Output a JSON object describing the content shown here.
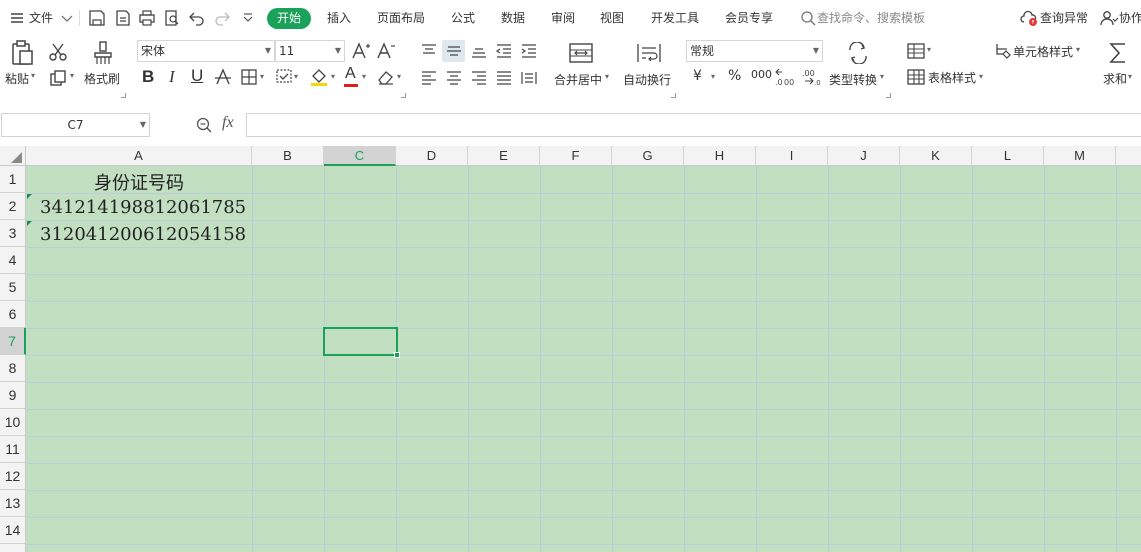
{
  "menubar": {
    "file": "文件",
    "tabs": [
      "开始",
      "插入",
      "页面布局",
      "公式",
      "数据",
      "审阅",
      "视图",
      "开发工具",
      "会员专享"
    ],
    "search_placeholder": "查找命令、搜索模板",
    "check_error": "查询异常",
    "collab": "协作"
  },
  "ribbon": {
    "paste": "粘贴",
    "format_painter": "格式刷",
    "font_name": "宋体",
    "font_size": "11",
    "bold": "B",
    "italic": "I",
    "underline": "U",
    "font_color_letter": "A",
    "merge_center": "合并居中",
    "wrap_text": "自动换行",
    "number_format": "常规",
    "currency": "¥",
    "percent": "%",
    "thousands": "000",
    "type_convert": "类型转换",
    "table_style": "表格样式",
    "cell_style": "单元格样式",
    "sum": "求和",
    "colors": {
      "font_color": "#e02020",
      "fill_color": "#f5d90a",
      "active_tab": "#1aa15a"
    }
  },
  "formula_bar": {
    "name_box": "C7",
    "fx_label": "fx",
    "formula": ""
  },
  "sheet": {
    "columns": [
      "A",
      "B",
      "C",
      "D",
      "E",
      "F",
      "G",
      "H",
      "I",
      "J",
      "K",
      "L",
      "M"
    ],
    "active_column": "C",
    "rows": [
      "1",
      "2",
      "3",
      "4",
      "5",
      "6",
      "7",
      "8",
      "9",
      "10",
      "11",
      "12",
      "13",
      "14"
    ],
    "active_row": "7",
    "cells": {
      "A1": "身份证号码",
      "A2": "341214198812061785",
      "A3": "312041200612054158"
    },
    "selected_cell": "C7",
    "colors": {
      "background": "#c2dfc2",
      "selection": "#1aa15a"
    }
  }
}
